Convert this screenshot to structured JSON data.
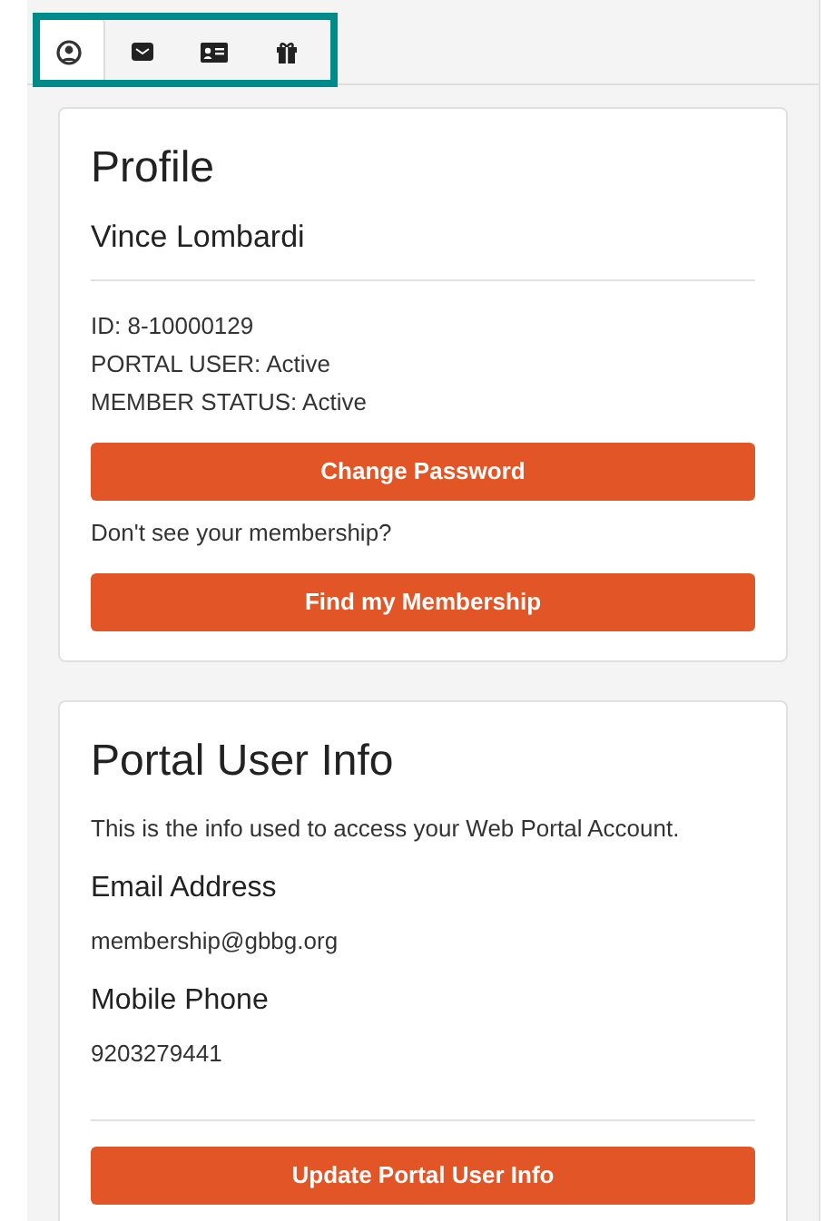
{
  "tabs": [
    {
      "kind": "person",
      "selected": true
    },
    {
      "kind": "envelope",
      "selected": false
    },
    {
      "kind": "card",
      "selected": false
    },
    {
      "kind": "gift",
      "selected": false
    }
  ],
  "profile": {
    "title": "Profile",
    "name": "Vince Lombardi",
    "details": [
      "ID: 8-10000129",
      "PORTAL USER: Active",
      "MEMBER STATUS: Active"
    ],
    "change_password_button": "Change Password",
    "prompt": "Don't see your membership?",
    "find_button": "Find my Membership"
  },
  "portal_user_info": {
    "title": "Portal User Info",
    "description": "This is the info used to access your Web Portal Account.",
    "fields": [
      {
        "label": "Email Address",
        "value": "membership@gbbg.org"
      },
      {
        "label": "Mobile Phone",
        "value": "9203279441"
      }
    ],
    "update_button": "Update Portal User Info"
  }
}
